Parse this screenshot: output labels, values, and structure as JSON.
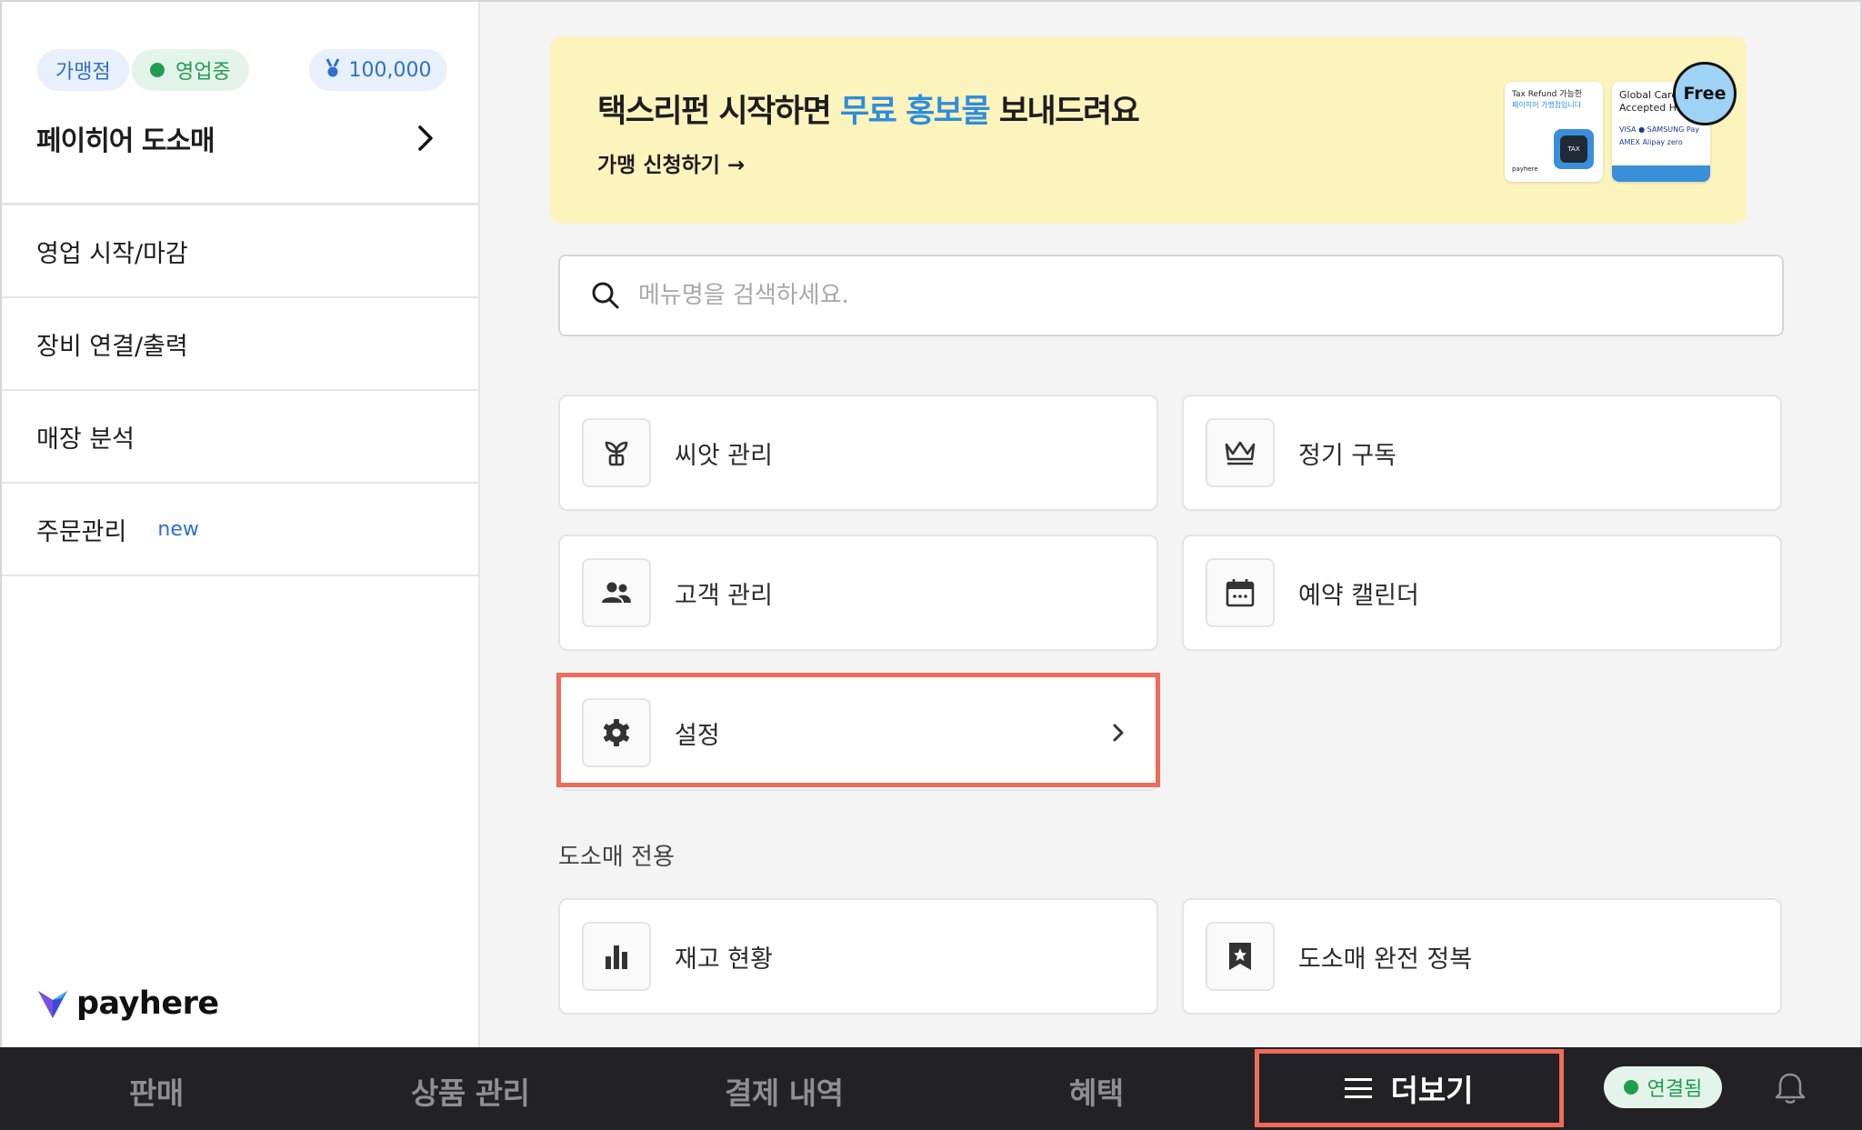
{
  "sidebar": {
    "franchise_chip": "가맹점",
    "status_chip": "영업중",
    "points_chip": "100,000",
    "store_name": "페이히어 도소매",
    "items": [
      {
        "label": "영업 시작/마감"
      },
      {
        "label": "장비 연결/출력"
      },
      {
        "label": "매장 분석"
      },
      {
        "label": "주문관리",
        "badge": "new"
      }
    ],
    "logo_text": "payhere"
  },
  "banner": {
    "title_prefix": "택스리펀 시작하면 ",
    "title_highlight": "무료 홍보물",
    "title_suffix": " 보내드려요",
    "link": "가맹 신청하기 →",
    "card_a_title": "Tax Refund 가능한",
    "card_a_sub": "페이히어 가맹점입니다",
    "card_a_badge": "TAX FREE",
    "card_a_brand": "payhere",
    "card_b_title": "Global Card Accepted Here",
    "card_b_logos": "VISA  ●  SAMSUNG Pay  AMEX  Alipay  zero",
    "free_badge": "Free"
  },
  "search": {
    "placeholder": "메뉴명을 검색하세요."
  },
  "menu": {
    "seed": "씨앗 관리",
    "subscription": "정기 구독",
    "customer": "고객 관리",
    "reservation": "예약 캘린더",
    "settings": "설정"
  },
  "wholesale": {
    "section_title": "도소매 전용",
    "inventory": "재고 현황",
    "conquest": "도소매 완전 정복"
  },
  "bottom_nav": {
    "sales": "판매",
    "products": "상품 관리",
    "payments": "결제 내역",
    "benefits": "혜택",
    "more": "더보기",
    "connection": "연결됨"
  },
  "colors": {
    "accent_blue": "#2f8ddc",
    "status_green": "#1f9e51",
    "highlight_red": "#ef6b5b",
    "banner_yellow": "#fdf3bd",
    "nav_dark": "#222226"
  }
}
